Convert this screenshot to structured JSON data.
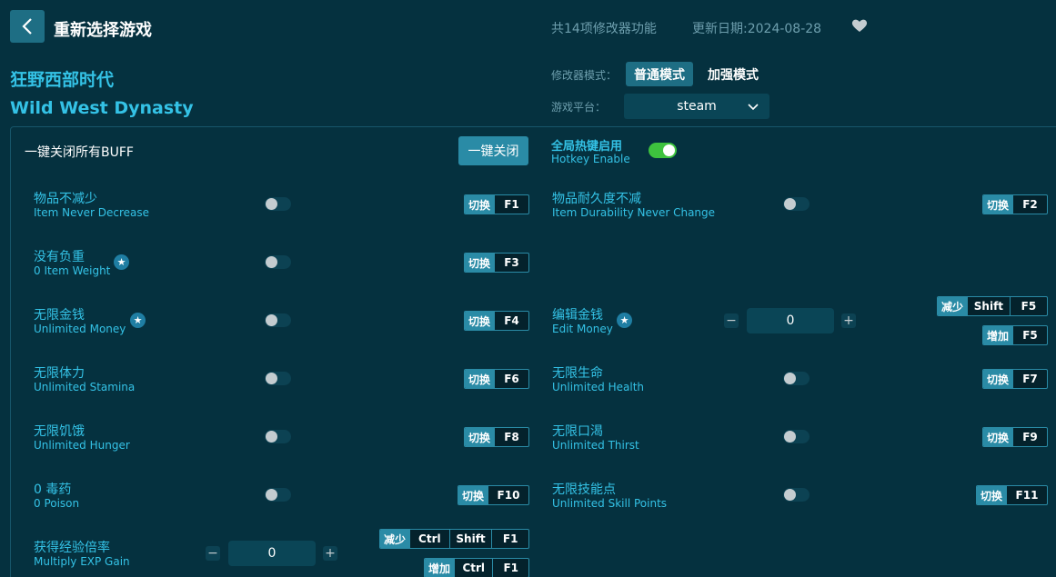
{
  "header": {
    "title": "重新选择游戏",
    "feature_count": "共14项修改器功能",
    "update_date": "更新日期:2024-08-28"
  },
  "game": {
    "name_cn": "狂野西部时代",
    "name_en": "Wild West Dynasty"
  },
  "mode": {
    "label": "修改器模式：",
    "options": [
      "普通模式",
      "加强模式"
    ],
    "selected": "普通模式"
  },
  "platform": {
    "label": "游戏平台：",
    "value": "steam"
  },
  "global": {
    "buff_label": "一键关闭所有BUFF",
    "close_all": "一键关闭",
    "hotkey_cn": "全局热键启用",
    "hotkey_en": "Hotkey Enable",
    "hotkey_enabled": true
  },
  "labels": {
    "toggle": "切换",
    "decrease": "减少",
    "increase": "增加"
  },
  "features": [
    {
      "cn": "物品不减少",
      "en": "Item Never Decrease",
      "key": "F1"
    },
    {
      "cn": "物品耐久度不减",
      "en": "Item Durability Never Change",
      "key": "F2"
    },
    {
      "cn": "没有负重",
      "en": "0 Item Weight",
      "key": "F3"
    },
    {
      "cn": "无限金钱",
      "en": "Unlimited Money",
      "key": "F4"
    },
    {
      "cn": "编辑金钱",
      "en": "Edit Money",
      "value": "0",
      "dec_keys": [
        "Shift",
        "F5"
      ],
      "inc_keys": [
        "F5"
      ]
    },
    {
      "cn": "无限体力",
      "en": "Unlimited Stamina",
      "key": "F6"
    },
    {
      "cn": "无限生命",
      "en": "Unlimited Health",
      "key": "F7"
    },
    {
      "cn": "无限饥饿",
      "en": "Unlimited Hunger",
      "key": "F8"
    },
    {
      "cn": "无限口渴",
      "en": "Unlimited Thirst",
      "key": "F9"
    },
    {
      "cn": "0 毒药",
      "en": "0 Poison",
      "key": "F10"
    },
    {
      "cn": "无限技能点",
      "en": "Unlimited Skill Points",
      "key": "F11"
    },
    {
      "cn": "获得经验倍率",
      "en": "Multiply EXP Gain",
      "value": "0",
      "dec_keys": [
        "Ctrl",
        "Shift",
        "F1"
      ],
      "inc_keys": [
        "Ctrl",
        "F1"
      ]
    }
  ],
  "colors": {
    "background": "#05313f",
    "accent": "#34c2e6",
    "button": "#2a8ba6",
    "switch_on": "#3ec23e"
  }
}
